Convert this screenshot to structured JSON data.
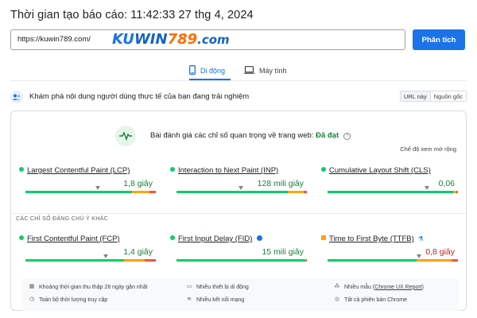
{
  "header": {
    "report_time": "Thời gian tạo báo cáo: 11:42:33 27 thg 4, 2024"
  },
  "search": {
    "url_value": "https://kuwin789.com/",
    "logo_text_1": "KU",
    "logo_text_2": "WIN",
    "logo_text_3": "789",
    "logo_text_4": ".com",
    "analyze_label": "Phân tích"
  },
  "tabs": [
    {
      "label": "Di động",
      "icon": "smartphone-icon",
      "active": true
    },
    {
      "label": "Máy tính",
      "icon": "laptop-icon",
      "active": false
    }
  ],
  "discover": {
    "text": "Khám phá nội dung người dùng thực tế của bạn đang trải nghiệm",
    "toggle_url": "URL này",
    "toggle_origin": "Nguồn gốc"
  },
  "assessment": {
    "text": "Bài đánh giá các chỉ số quan trọng về trang web:",
    "result": "Đã đạt",
    "expand": "Chế độ xem mở rộng"
  },
  "core_metrics": [
    {
      "name": "Largest Contentful Paint (LCP)",
      "value": "1,8 giây"
    },
    {
      "name": "Interaction to Next Paint (INP)",
      "value": "128 mili giây"
    },
    {
      "name": "Cumulative Layout Shift (CLS)",
      "value": "0,06"
    }
  ],
  "other_heading": "CÁC CHỈ SỐ ĐÁNG CHÚ Ý KHÁC",
  "other_metrics": [
    {
      "name": "First Contentful Paint (FCP)",
      "value": "1,4 giây"
    },
    {
      "name": "First Input Delay (FID)",
      "value": "15 mili giây"
    },
    {
      "name": "Time to First Byte (TTFB)",
      "value": "0,8 giây"
    }
  ],
  "footer": {
    "collection_period": "Khoảng thời gian thu thập 28 ngày gần nhất",
    "devices": "Nhiều thiết bị di động",
    "samples_prefix": "Nhiều mẫu (",
    "samples_link": "Chrome UX Report",
    "samples_suffix": ")",
    "full_duration": "Toàn bộ thời lượng truy cập",
    "network": "Nhiều kết nối mạng",
    "all_chrome": "Tất cả phiên bản Chrome"
  },
  "colors": {
    "accent": "#1a73e8",
    "good": "#0cce6b",
    "needs_improvement": "#ffa400",
    "poor": "#ff4e42",
    "pass_text": "#188038"
  }
}
